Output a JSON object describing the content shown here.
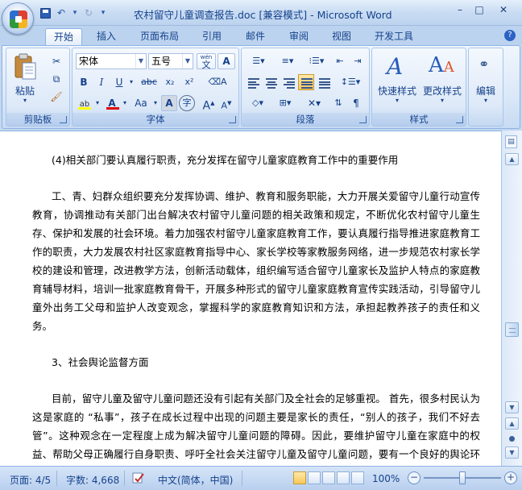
{
  "window": {
    "title": "农村留守儿童调查报告.doc [兼容模式] - Microsoft Word",
    "controls": {
      "minimize": "–",
      "maximize": "□",
      "close": "✕"
    }
  },
  "qat": {
    "undo": "↶",
    "redo": "↻",
    "more": "▾"
  },
  "tabs": [
    "开始",
    "插入",
    "页面布局",
    "引用",
    "邮件",
    "审阅",
    "视图",
    "开发工具"
  ],
  "ribbon": {
    "clipboard": {
      "label": "剪贴板",
      "paste": "粘贴"
    },
    "font": {
      "label": "字体",
      "font_name": "宋体",
      "font_size": "五号",
      "bold": "B",
      "italic": "I",
      "underline": "U",
      "strike": "abc",
      "subscript": "x₂",
      "superscript": "x²",
      "change_case": "Aa",
      "char_shading": "A",
      "enclose": "字",
      "grow": "A",
      "shrink": "A",
      "clear": "A",
      "wen": "wén",
      "highlight_color": "#ffff00",
      "font_color": "#e00000"
    },
    "paragraph": {
      "label": "段落"
    },
    "styles": {
      "label": "样式",
      "quick_styles": "快速样式",
      "change_styles": "更改样式"
    },
    "editing": {
      "label": "编辑"
    }
  },
  "document": {
    "paragraphs": [
      {
        "type": "heading",
        "text": "(4)相关部门要认真履行职责，充分发挥在留守儿童家庭教育工作中的重要作用"
      },
      {
        "type": "body",
        "text": "工、青、妇群众组织要充分发挥协调、维护、教育和服务职能，大力开展关爱留守儿童行动宣传教育，协调推动有关部门出台解决农村留守儿童问题的相关政策和规定，不断优化农村留守儿童生存、保护和发展的社会环境。着力加强农村留守儿童家庭教育工作，要认真履行指导推进家庭教育工作的职责，大力发展农村社区家庭教育指导中心、家长学校等家教服务网络，进一步规范农村家长学校的建设和管理，改进教学方法，创新活动载体，组织编写适合留守儿童家长及监护人特点的家庭教育辅导材料，培训一批家庭教育骨干，开展多种形式的留守儿童家庭教育宣传实践活动，引导留守儿童外出务工父母和监护人改变观念，掌握科学的家庭教育知识和方法，承担起教养孩子的责任和义务。"
      },
      {
        "type": "heading",
        "text": "3、社会舆论监督方面"
      },
      {
        "type": "body",
        "text": "目前，留守儿童及留守儿童问题还没有引起有关部门及全社会的足够重视。 首先，很多村民认为这是家庭的 “私事”，孩子在成长过程中出现的问题主要是家长的责任，“别人的孩子，我们不好去管”。这种观念在一定程度上成为解决留守儿童问题的障碍。因此，要维护留守儿童在家庭中的权益、帮助父母正确履行自身职责、呼吁全社会关注留守儿童及留守儿童问题，要有一个良好的舆论环境。"
      }
    ]
  },
  "statusbar": {
    "page": "页面: 4/5",
    "words": "字数: 4,668",
    "language": "中文(简体，中国)",
    "zoom": "100%",
    "zoom_minus": "−",
    "zoom_plus": "+",
    "zoom_level_fraction": 0.5
  }
}
